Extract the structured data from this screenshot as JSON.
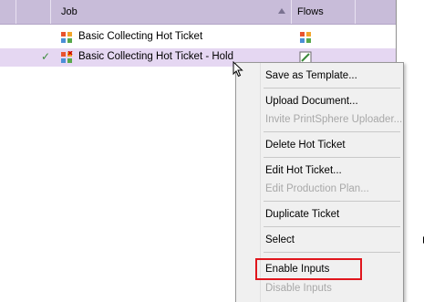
{
  "columns": {
    "job": "Job",
    "flows": "Flows"
  },
  "rows": [
    {
      "label": "Basic Collecting Hot Ticket",
      "checked": false
    },
    {
      "label": "Basic Collecting Hot Ticket - Hold",
      "checked": true
    }
  ],
  "menu": {
    "items": [
      {
        "label": "Save as Template...",
        "enabled": true
      },
      {
        "label": "Upload Document...",
        "enabled": true
      },
      {
        "label": "Invite PrintSphere Uploader...",
        "enabled": false
      },
      {
        "label": "Delete Hot Ticket",
        "enabled": true
      },
      {
        "label": "Edit Hot Ticket...",
        "enabled": true
      },
      {
        "label": "Edit Production Plan...",
        "enabled": false
      },
      {
        "label": "Duplicate Ticket",
        "enabled": true
      },
      {
        "label": "Select",
        "enabled": true,
        "submenu": true
      },
      {
        "label": "Enable Inputs",
        "enabled": true,
        "highlighted": true
      },
      {
        "label": "Disable Inputs",
        "enabled": false
      }
    ]
  },
  "colors": {
    "header": "#c8bcd9",
    "selected_row": "#e5d7f2",
    "highlight_box": "#e0161d"
  }
}
